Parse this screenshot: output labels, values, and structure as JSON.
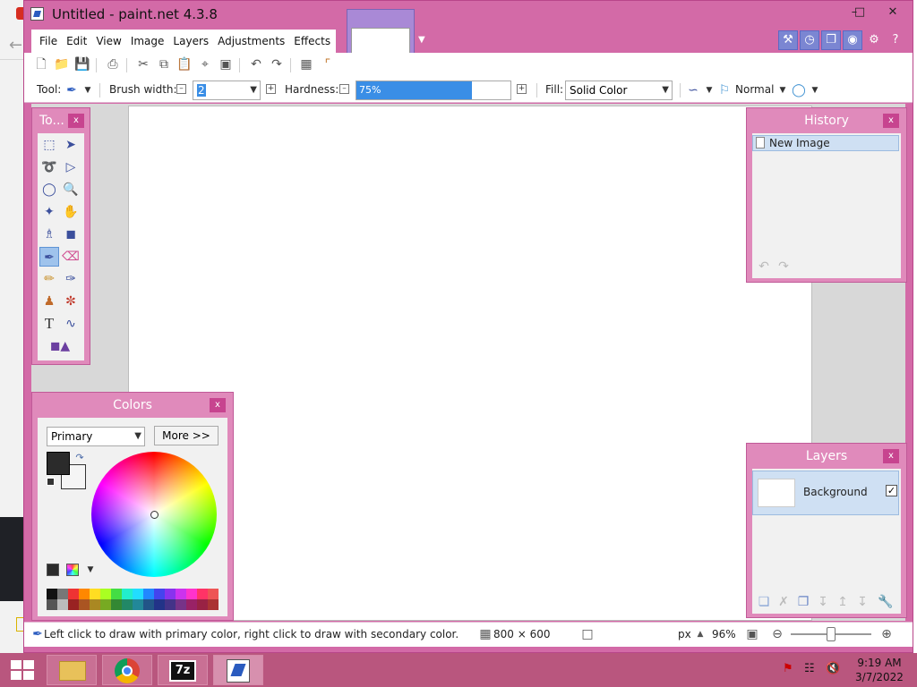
{
  "window": {
    "title": "Untitled - paint.net 4.3.8",
    "min_label": "–",
    "max_label": "□",
    "close_label": "✕"
  },
  "menu": [
    "File",
    "Edit",
    "View",
    "Image",
    "Layers",
    "Adjustments",
    "Effects"
  ],
  "toolbar": {
    "tool_label": "Tool:",
    "brush_width_label": "Brush width:",
    "brush_width_value": "2",
    "hardness_label": "Hardness:",
    "hardness_value": "75%",
    "hardness_fraction": 0.75,
    "fill_label": "Fill:",
    "fill_value": "Solid Color",
    "blend_mode": "Normal"
  },
  "panels": {
    "tools_title": "To...",
    "history_title": "History",
    "history_item": "New Image",
    "colors_title": "Colors",
    "colors_mode": "Primary",
    "colors_more": "More >>",
    "layers_title": "Layers",
    "layer_name": "Background",
    "close_x": "x"
  },
  "status": {
    "hint": "Left click to draw with primary color, right click to draw with secondary color.",
    "size": "800 × 600",
    "unit": "px",
    "zoom": "96%"
  },
  "taskbar": {
    "time": "9:19 AM",
    "date": "3/7/2022",
    "seven_zip": "7z"
  },
  "colors": {
    "chrome": "#d36aa7",
    "panel": "#e08abb",
    "selection": "#3a8ee6",
    "primary": "#2b2b2b",
    "secondary": "#f5f5f5"
  }
}
